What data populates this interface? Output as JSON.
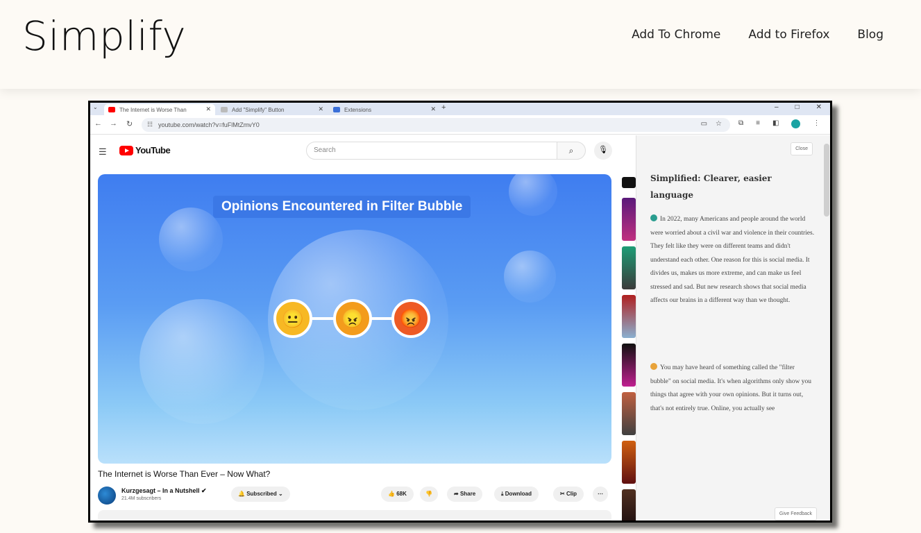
{
  "site": {
    "brand": "Simplify",
    "nav": [
      "Add To Chrome",
      "Add to Firefox",
      "Blog"
    ]
  },
  "browser": {
    "tabs": [
      {
        "title": "The Internet is Worse Than",
        "active": true
      },
      {
        "title": "Add \"Simplify\" Button",
        "active": false
      },
      {
        "title": "Extensions",
        "active": false
      }
    ],
    "url": "youtube.com/watch?v=fuFlMtZmvY0"
  },
  "youtube": {
    "search_placeholder": "Search",
    "logo_text": "YouTube",
    "video_overlay_title": "Opinions Encountered in Filter Bubble",
    "video_title": "The Internet is Worse Than Ever – Now What?",
    "channel_name": "Kurzgesagt – In a Nutshell",
    "subscribers": "21.4M subscribers",
    "subscribed_label": "Subscribed",
    "likes": "68K",
    "share_label": "Share",
    "download_label": "Download",
    "clip_label": "Clip",
    "faces": [
      "😐",
      "😠",
      "😡"
    ]
  },
  "panel": {
    "close_label": "Close",
    "title": "Simplified: Clearer, easier language",
    "paragraph1": "In 2022, many Americans and people around the world were worried about a civil war and violence in their countries. They felt like they were on different teams and didn't understand each other. One reason for this is social media. It divides us, makes us more extreme, and can make us feel stressed and sad. But new research shows that social media affects our brains in a different way than we thought.",
    "paragraph2": "You may have heard of something called the \"filter bubble\" on social media. It's when algorithms only show you things that agree with your own opinions. But it turns out, that's not entirely true. Online, you actually see",
    "feedback_label": "Give Feedback"
  }
}
